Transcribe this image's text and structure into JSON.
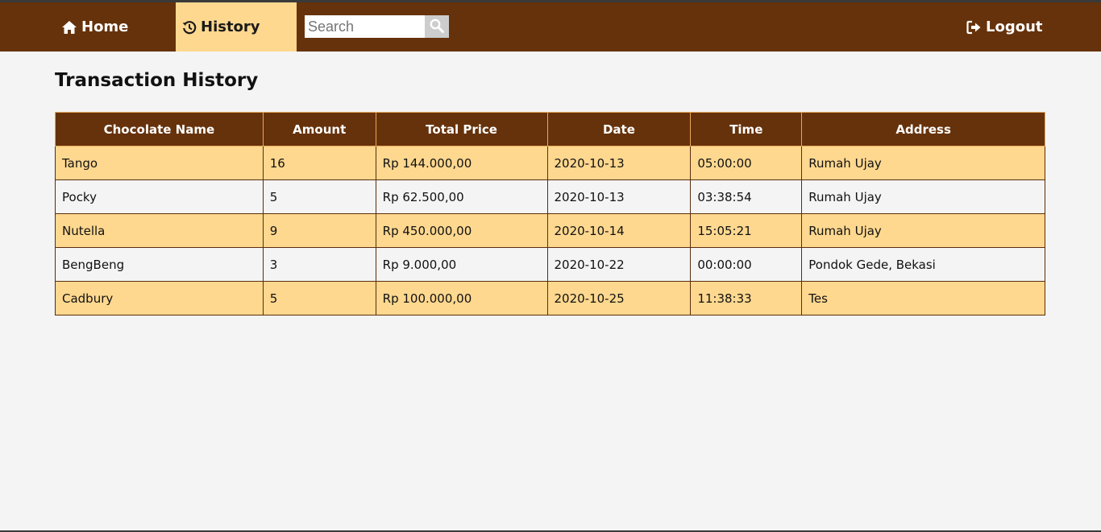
{
  "nav": {
    "home_label": "Home",
    "history_label": "History",
    "logout_label": "Logout",
    "search_placeholder": "Search",
    "active_color": "#fed88f",
    "bar_color": "#66320b"
  },
  "page": {
    "title": "Transaction History"
  },
  "table": {
    "columns": [
      "Chocolate Name",
      "Amount",
      "Total Price",
      "Date",
      "Time",
      "Address"
    ],
    "rows": [
      [
        "Tango",
        "16",
        "Rp 144.000,00",
        "2020-10-13",
        "05:00:00",
        "Rumah Ujay"
      ],
      [
        "Pocky",
        "5",
        "Rp 62.500,00",
        "2020-10-13",
        "03:38:54",
        "Rumah Ujay"
      ],
      [
        "Nutella",
        "9",
        "Rp 450.000,00",
        "2020-10-14",
        "15:05:21",
        "Rumah Ujay"
      ],
      [
        "BengBeng",
        "3",
        "Rp 9.000,00",
        "2020-10-22",
        "00:00:00",
        "Pondok Gede, Bekasi"
      ],
      [
        "Cadbury",
        "5",
        "Rp 100.000,00",
        "2020-10-25",
        "11:38:33",
        "Tes"
      ]
    ]
  },
  "icons": {
    "home": "home-icon",
    "history": "history-icon",
    "search": "search-icon",
    "logout": "logout-icon"
  }
}
